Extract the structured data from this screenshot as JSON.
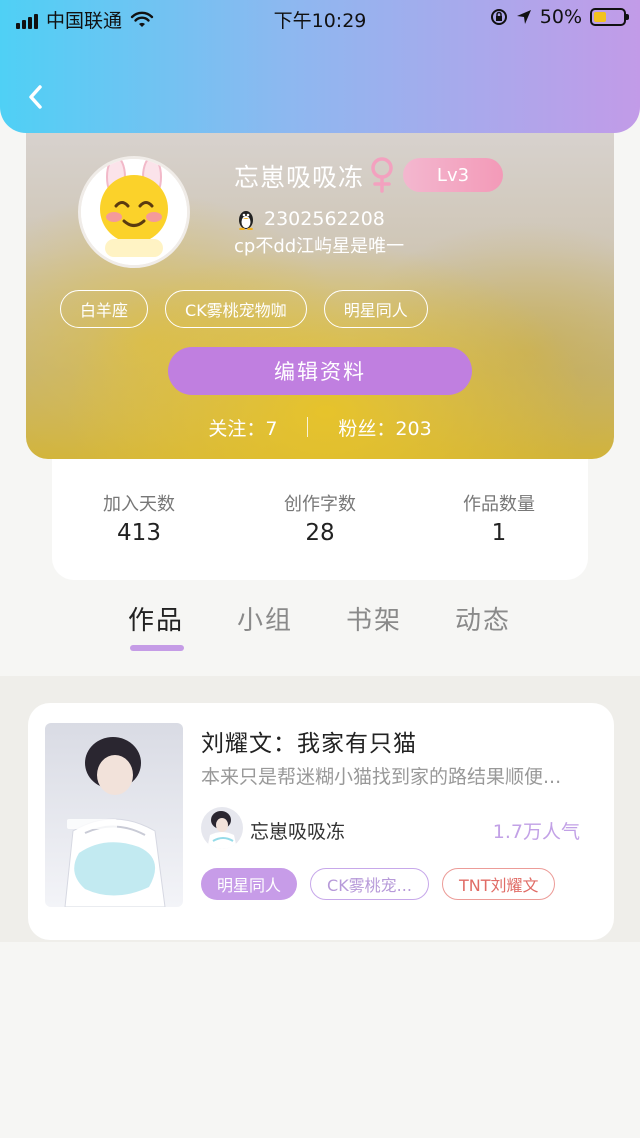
{
  "status_bar": {
    "carrier": "中国联通",
    "time": "下午10:29",
    "battery_percent": "50%",
    "battery_level": 0.5
  },
  "header": {
    "back_icon": "chevron-left-icon"
  },
  "profile": {
    "username": "忘崽吸吸冻",
    "gender_icon": "female-icon",
    "level": "Lv3",
    "qq_number": "2302562208",
    "bio": "cp不dd江屿星是唯一",
    "tags": [
      "白羊座",
      "CK雾桃宠物咖",
      "明星同人"
    ],
    "edit_button": "编辑资料",
    "following_label": "关注：7",
    "followers_label": "粉丝：203"
  },
  "stats": [
    {
      "label": "加入天数",
      "value": "413"
    },
    {
      "label": "创作字数",
      "value": "28"
    },
    {
      "label": "作品数量",
      "value": "1"
    }
  ],
  "tabs": [
    "作品",
    "小组",
    "书架",
    "动态"
  ],
  "active_tab": "作品",
  "works": [
    {
      "title": "刘耀文：我家有只猫",
      "description": "本来只是帮迷糊小猫找到家的路结果顺便...",
      "author": "忘崽吸吸冻",
      "popularity": "1.7万人气",
      "tags": [
        "明星同人",
        "CK雾桃宠...",
        "TNT刘耀文"
      ]
    }
  ],
  "colors": {
    "header_gradient": [
      "#4fd0f5",
      "#8db8f0",
      "#c29be8"
    ],
    "accent_purple": "#c07fe0",
    "level_pink": "#f39ab8",
    "popularity_purple": "#c2a1e6",
    "tag_red": "#e06c66"
  }
}
